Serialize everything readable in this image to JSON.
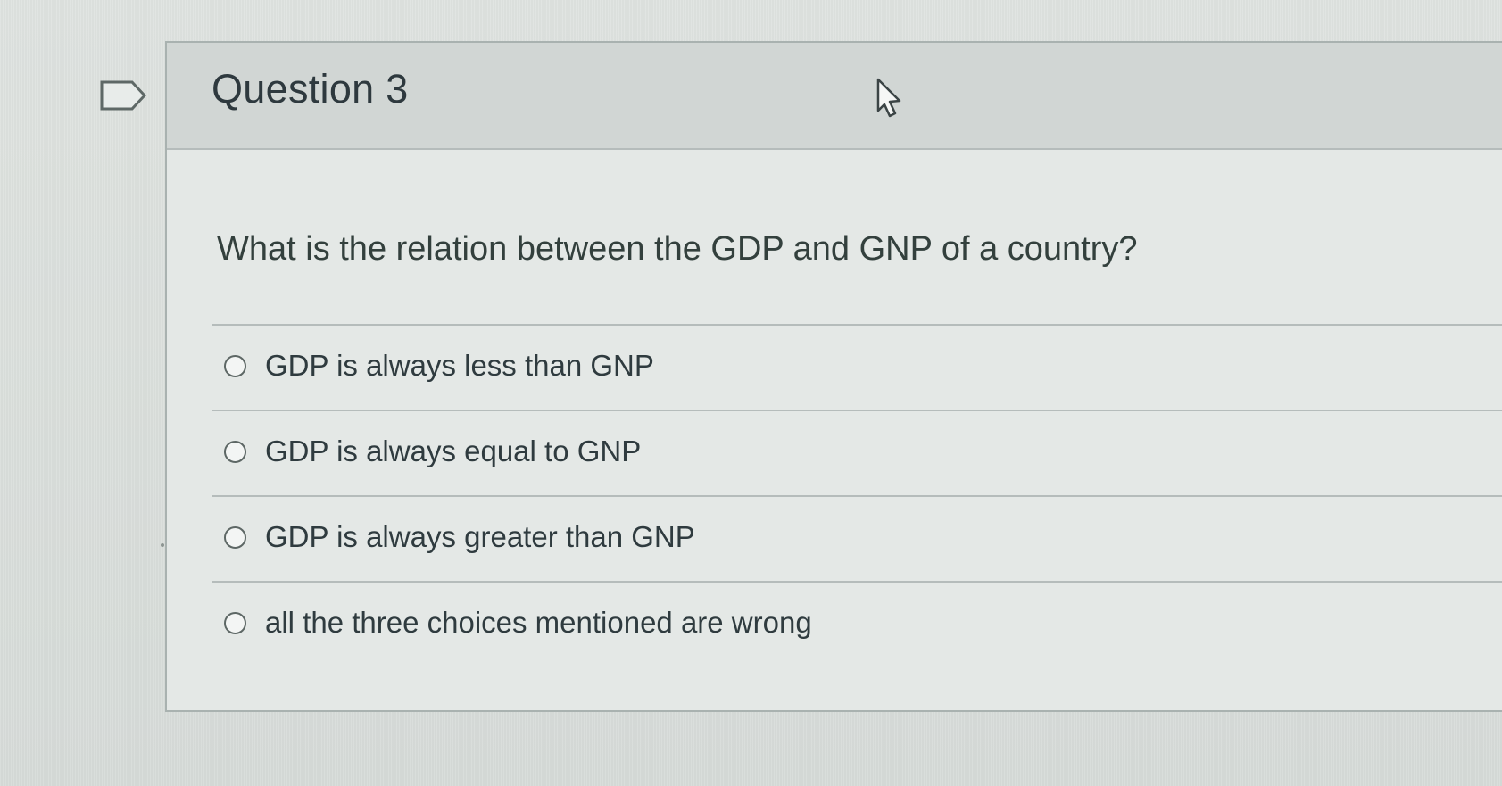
{
  "question": {
    "title": "Question 3",
    "prompt": "What is the relation between the GDP and GNP of a country?",
    "options": [
      {
        "label": "GDP is always less than GNP",
        "selected": false
      },
      {
        "label": "GDP is always equal to GNP",
        "selected": false
      },
      {
        "label": "GDP is always greater than GNP",
        "selected": false
      },
      {
        "label": "all the three choices mentioned are wrong",
        "selected": false
      }
    ]
  },
  "icons": {
    "flag": "flag-outline-icon",
    "cursor": "mouse-pointer-icon"
  },
  "colors": {
    "background": "#d9dedb",
    "header": "#d1d6d4",
    "text": "#2f3b3f",
    "border": "#b5bcbb"
  }
}
